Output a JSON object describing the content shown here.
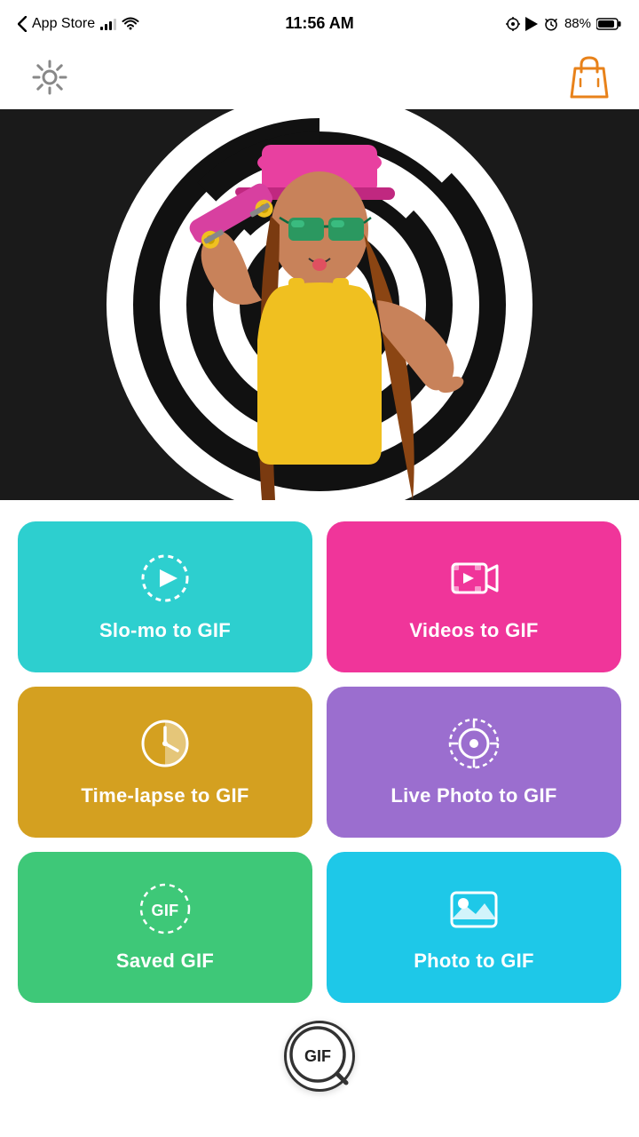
{
  "statusBar": {
    "carrier": "App Store",
    "time": "11:56 AM",
    "battery": "88%",
    "batteryColor": "#000"
  },
  "header": {
    "settingsIcon": "gear-icon",
    "bagIcon": "shopping-bag-icon",
    "bagColor": "#e8821a"
  },
  "hero": {
    "altText": "Stylish woman with skateboard and spiral background"
  },
  "buttons": [
    {
      "id": "slomo",
      "label": "Slo-mo to GIF",
      "icon": "play-circle-dotted",
      "color": "#2dcfcf"
    },
    {
      "id": "videos",
      "label": "Videos to GIF",
      "icon": "video-play",
      "color": "#f0359a"
    },
    {
      "id": "timelapse",
      "label": "Time-lapse to GIF",
      "icon": "clock-half",
      "color": "#d4a020"
    },
    {
      "id": "livephoto",
      "label": "Live Photo to GIF",
      "icon": "target-dotted",
      "color": "#9b6ecf"
    },
    {
      "id": "savedgif",
      "label": "Saved GIF",
      "icon": "gif-dashed",
      "color": "#3ec878"
    },
    {
      "id": "phototogif",
      "label": "Photo to GIF",
      "icon": "photo-mountain",
      "color": "#1ec8e8"
    }
  ],
  "bottomBar": {
    "gifSearchLabel": "GIF"
  }
}
